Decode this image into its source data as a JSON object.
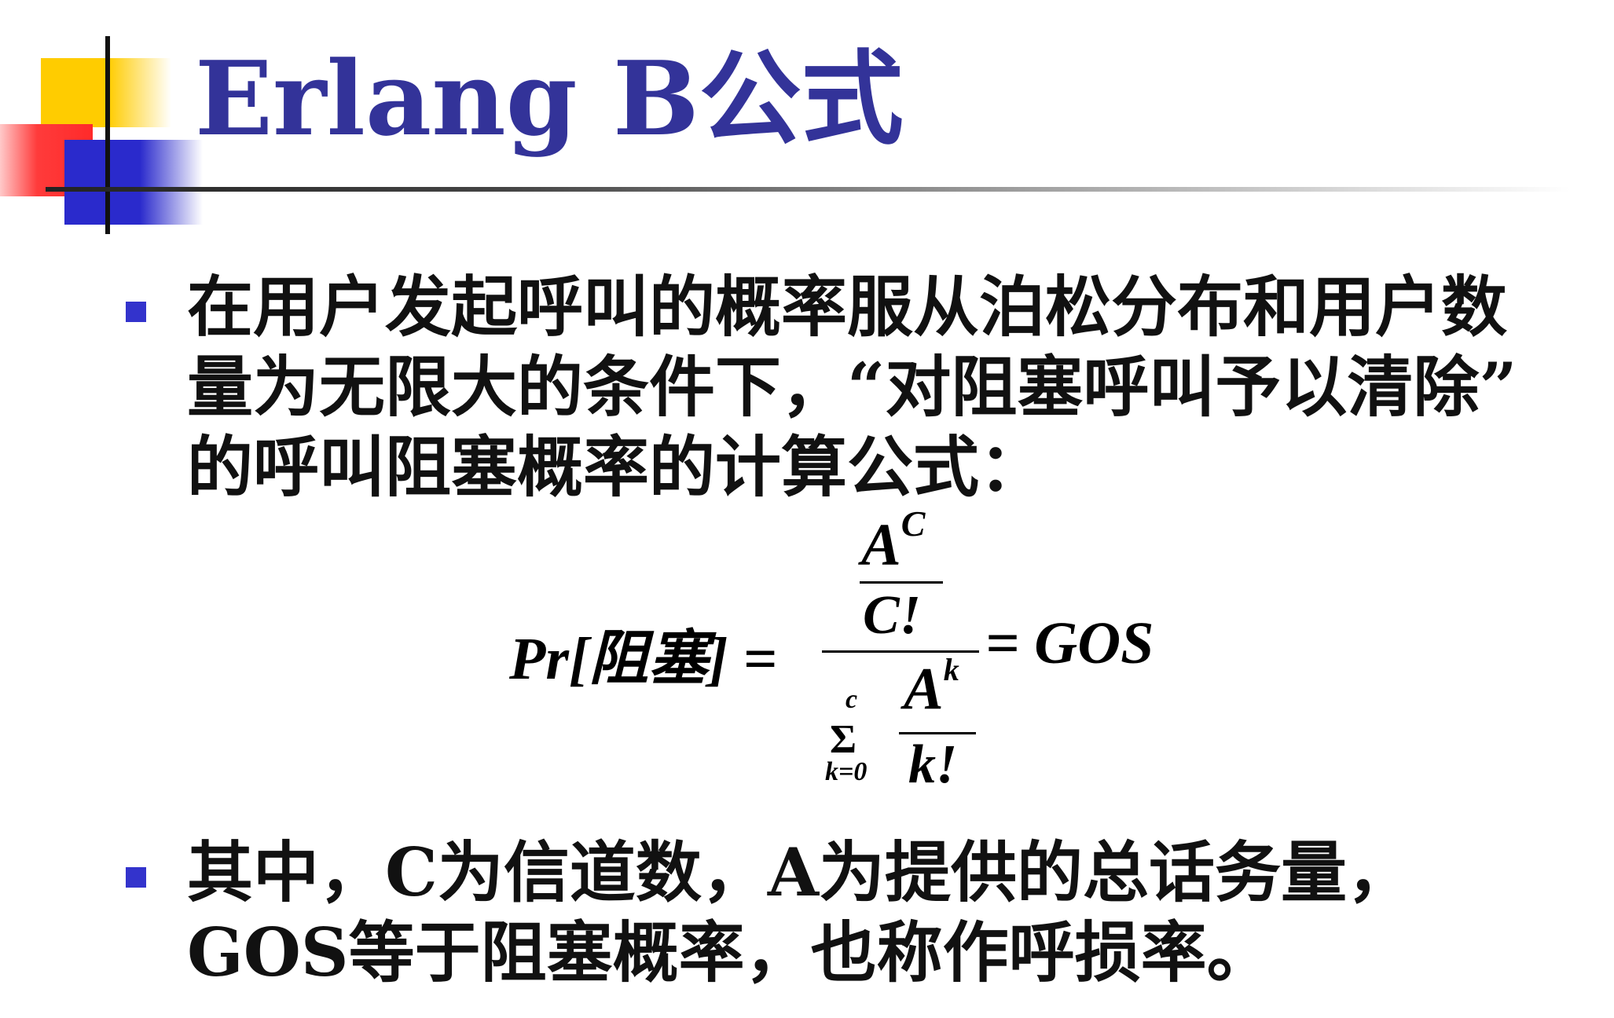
{
  "slide": {
    "title": "Erlang B公式",
    "bullets": [
      {
        "lines": [
          "在用户发起呼叫的概率服从泊松分布和用户数",
          "量为无限大的条件下，“对阻塞呼叫予以清除”",
          "的呼叫阻塞概率的计算公式："
        ]
      },
      {
        "lines": [
          "其中，C为信道数，A为提供的总话务量，",
          "GOS等于阻塞概率，也称作呼损率。"
        ]
      }
    ]
  },
  "formula": {
    "lhs": "Pr[阻塞] =",
    "numerator_base": "A",
    "numerator_exponent": "C",
    "numerator_denominator": "C!",
    "sum_symbol": "Σ",
    "sum_upper": "c",
    "sum_lower": "k=0",
    "denominator_base": "A",
    "denominator_exponent": "k",
    "denominator_denominator": "k!",
    "rhs": "= GOS"
  },
  "colors": {
    "title": "#333399",
    "bullet": "#3333cc",
    "deco_yellow": "#ffcc00",
    "deco_red": "#ff3b3b",
    "deco_blue": "#2a2acc"
  }
}
